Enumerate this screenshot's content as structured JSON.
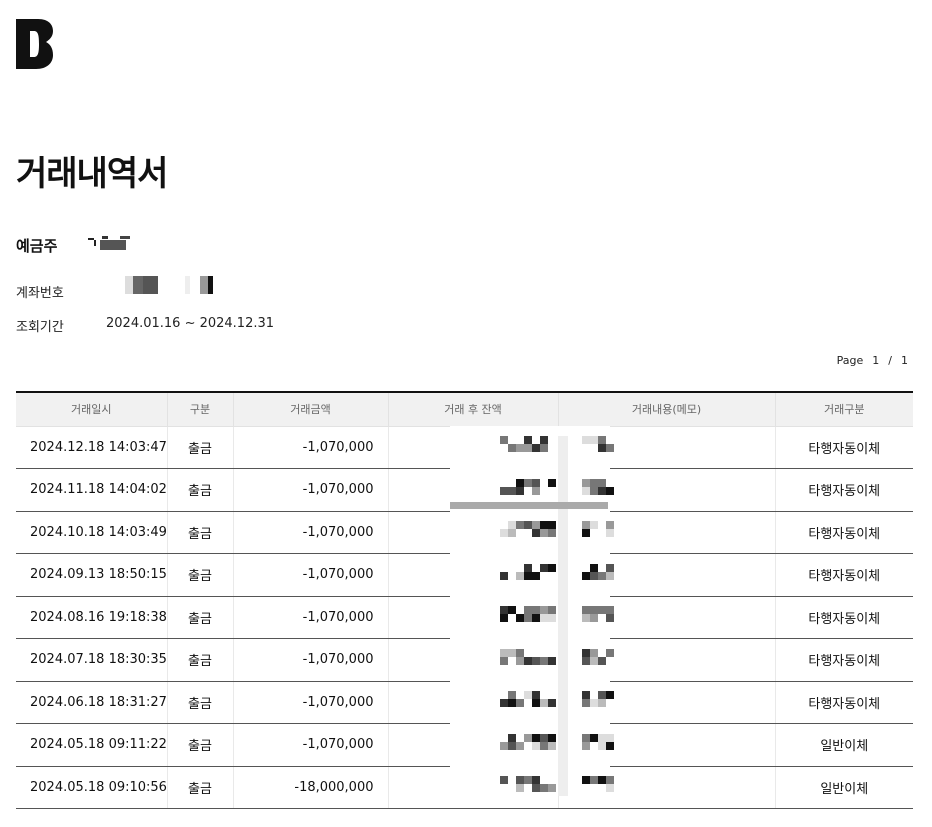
{
  "document": {
    "title": "거래내역서",
    "holder_label": "예금주",
    "account_label": "계좌번호",
    "period_label": "조회기간",
    "period_value": "2024.01.16 ~ 2024.12.31",
    "page": {
      "label": "Page",
      "current": "1",
      "separator": "/",
      "total": "1"
    }
  },
  "table": {
    "headers": [
      "거래일시",
      "구분",
      "거래금액",
      "거래 후 잔액",
      "거래내용(메모)",
      "거래구분"
    ],
    "rows": [
      {
        "datetime": "2024.12.18 14:03:47",
        "type": "출금",
        "amount": "-1,070,000",
        "category": "타행자동이체"
      },
      {
        "datetime": "2024.11.18 14:04:02",
        "type": "출금",
        "amount": "-1,070,000",
        "category": "타행자동이체"
      },
      {
        "datetime": "2024.10.18 14:03:49",
        "type": "출금",
        "amount": "-1,070,000",
        "category": "타행자동이체"
      },
      {
        "datetime": "2024.09.13 18:50:15",
        "type": "출금",
        "amount": "-1,070,000",
        "category": "타행자동이체"
      },
      {
        "datetime": "2024.08.16 19:18:38",
        "type": "출금",
        "amount": "-1,070,000",
        "category": "타행자동이체"
      },
      {
        "datetime": "2024.07.18 18:30:35",
        "type": "출금",
        "amount": "-1,070,000",
        "category": "타행자동이체"
      },
      {
        "datetime": "2024.06.18 18:31:27",
        "type": "출금",
        "amount": "-1,070,000",
        "category": "타행자동이체"
      },
      {
        "datetime": "2024.05.18 09:11:22",
        "type": "출금",
        "amount": "-1,070,000",
        "category": "일반이체"
      },
      {
        "datetime": "2024.05.18 09:10:56",
        "type": "출금",
        "amount": "-18,000,000",
        "category": "일반이체"
      }
    ]
  },
  "colors": {
    "text": "#111111",
    "header_bg": "#f1f1f1",
    "rule": "#111111"
  },
  "icons": {
    "logo": "brand-b-logo"
  }
}
